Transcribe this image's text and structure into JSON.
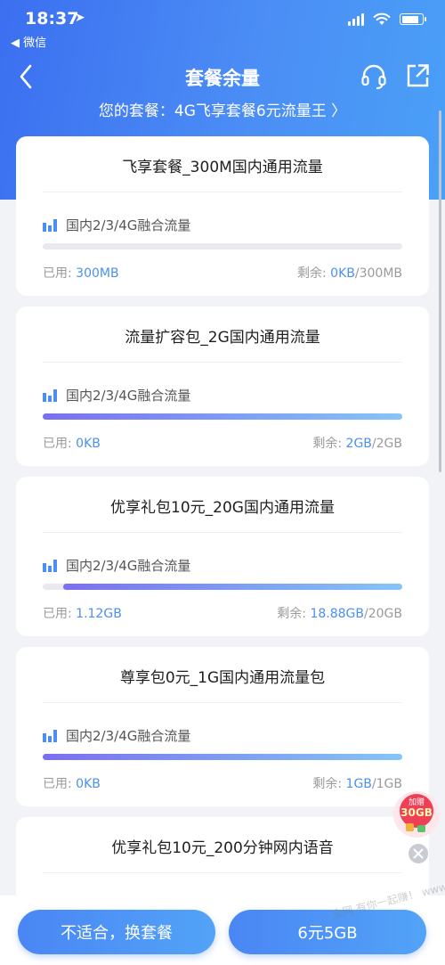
{
  "status_bar": {
    "time": "18:37",
    "back_app": "◀ 微信"
  },
  "nav": {
    "title": "套餐余量",
    "plan_label": "您的套餐：4G飞享套餐6元流量王"
  },
  "cards": [
    {
      "title": "飞享套餐_300M国内通用流量",
      "type_label": "国内2/3/4G融合流量",
      "used_label": "已用: ",
      "used_value": "300MB",
      "remain_label": "剩余: ",
      "remain_value": "0KB",
      "total": "/300MB",
      "used_fraction": 1.0
    },
    {
      "title": "流量扩容包_2G国内通用流量",
      "type_label": "国内2/3/4G融合流量",
      "used_label": "已用: ",
      "used_value": "0KB",
      "remain_label": "剩余: ",
      "remain_value": "2GB",
      "total": "/2GB",
      "used_fraction": 0.0
    },
    {
      "title": "优享礼包10元_20G国内通用流量",
      "type_label": "国内2/3/4G融合流量",
      "used_label": "已用: ",
      "used_value": "1.12GB",
      "remain_label": "剩余: ",
      "remain_value": "18.88GB",
      "total": "/20GB",
      "used_fraction": 0.056
    },
    {
      "title": "尊享包0元_1G国内通用流量包",
      "type_label": "国内2/3/4G融合流量",
      "used_label": "已用: ",
      "used_value": "0KB",
      "remain_label": "剩余: ",
      "remain_value": "1GB",
      "total": "/1GB",
      "used_fraction": 0.0
    },
    {
      "title": "优享礼包10元_200分钟网内语音"
    }
  ],
  "promo": {
    "top_text": "加赠",
    "amount": "30GB"
  },
  "buttons": {
    "change_plan": "不适合，换套餐",
    "buy": "6元5GB"
  },
  "watermark": "全网  有你一起赚！  www.ruanke8.com",
  "colors": {
    "brand_blue": "#4b8ff2",
    "header_gradient_start": "#3b6ff0",
    "header_gradient_end": "#4aa0f7",
    "promo_red": "#e8354d"
  }
}
